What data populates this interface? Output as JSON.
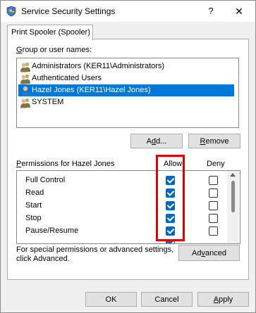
{
  "window": {
    "title": "Service Security Settings",
    "help": "?",
    "close": "✕"
  },
  "tab": {
    "label": "Print Spooler (Spooler)"
  },
  "group": {
    "label_pre": "",
    "label_ul": "G",
    "label_post": "roup or user names:",
    "items": [
      {
        "name": "Administrators (KER11\\Administrators)",
        "icon": "users-group-icon"
      },
      {
        "name": "Authenticated Users",
        "icon": "users-group-icon"
      },
      {
        "name": "Hazel Jones (KER11\\Hazel Jones)",
        "icon": "user-icon",
        "selected": true
      },
      {
        "name": "SYSTEM",
        "icon": "users-group-icon"
      }
    ],
    "add_pre": "A",
    "add_ul": "d",
    "add_post": "d...",
    "remove_pre": "",
    "remove_ul": "R",
    "remove_post": "emove"
  },
  "permissions": {
    "label_pre": "",
    "label_ul": "P",
    "label_post": "ermissions for Hazel Jones",
    "allow_header": "Allow",
    "deny_header": "Deny",
    "rows": [
      {
        "name": "Full Control",
        "allow": true,
        "deny": false
      },
      {
        "name": "Read",
        "allow": true,
        "deny": false
      },
      {
        "name": "Start",
        "allow": true,
        "deny": false
      },
      {
        "name": "Stop",
        "allow": true,
        "deny": false
      },
      {
        "name": "Pause/Resume",
        "allow": true,
        "deny": false
      }
    ]
  },
  "advanced": {
    "note_line1": "For special permissions or advanced settings,",
    "note_line2": "click Advanced.",
    "btn_pre": "Ad",
    "btn_ul": "v",
    "btn_post": "anced"
  },
  "footer": {
    "ok": "OK",
    "cancel": "Cancel",
    "apply_pre": "",
    "apply_ul": "A",
    "apply_post": "pply"
  },
  "colors": {
    "selection": "#0078d7",
    "checkbox_checked": "#0067c0",
    "highlight": "#e00000"
  }
}
